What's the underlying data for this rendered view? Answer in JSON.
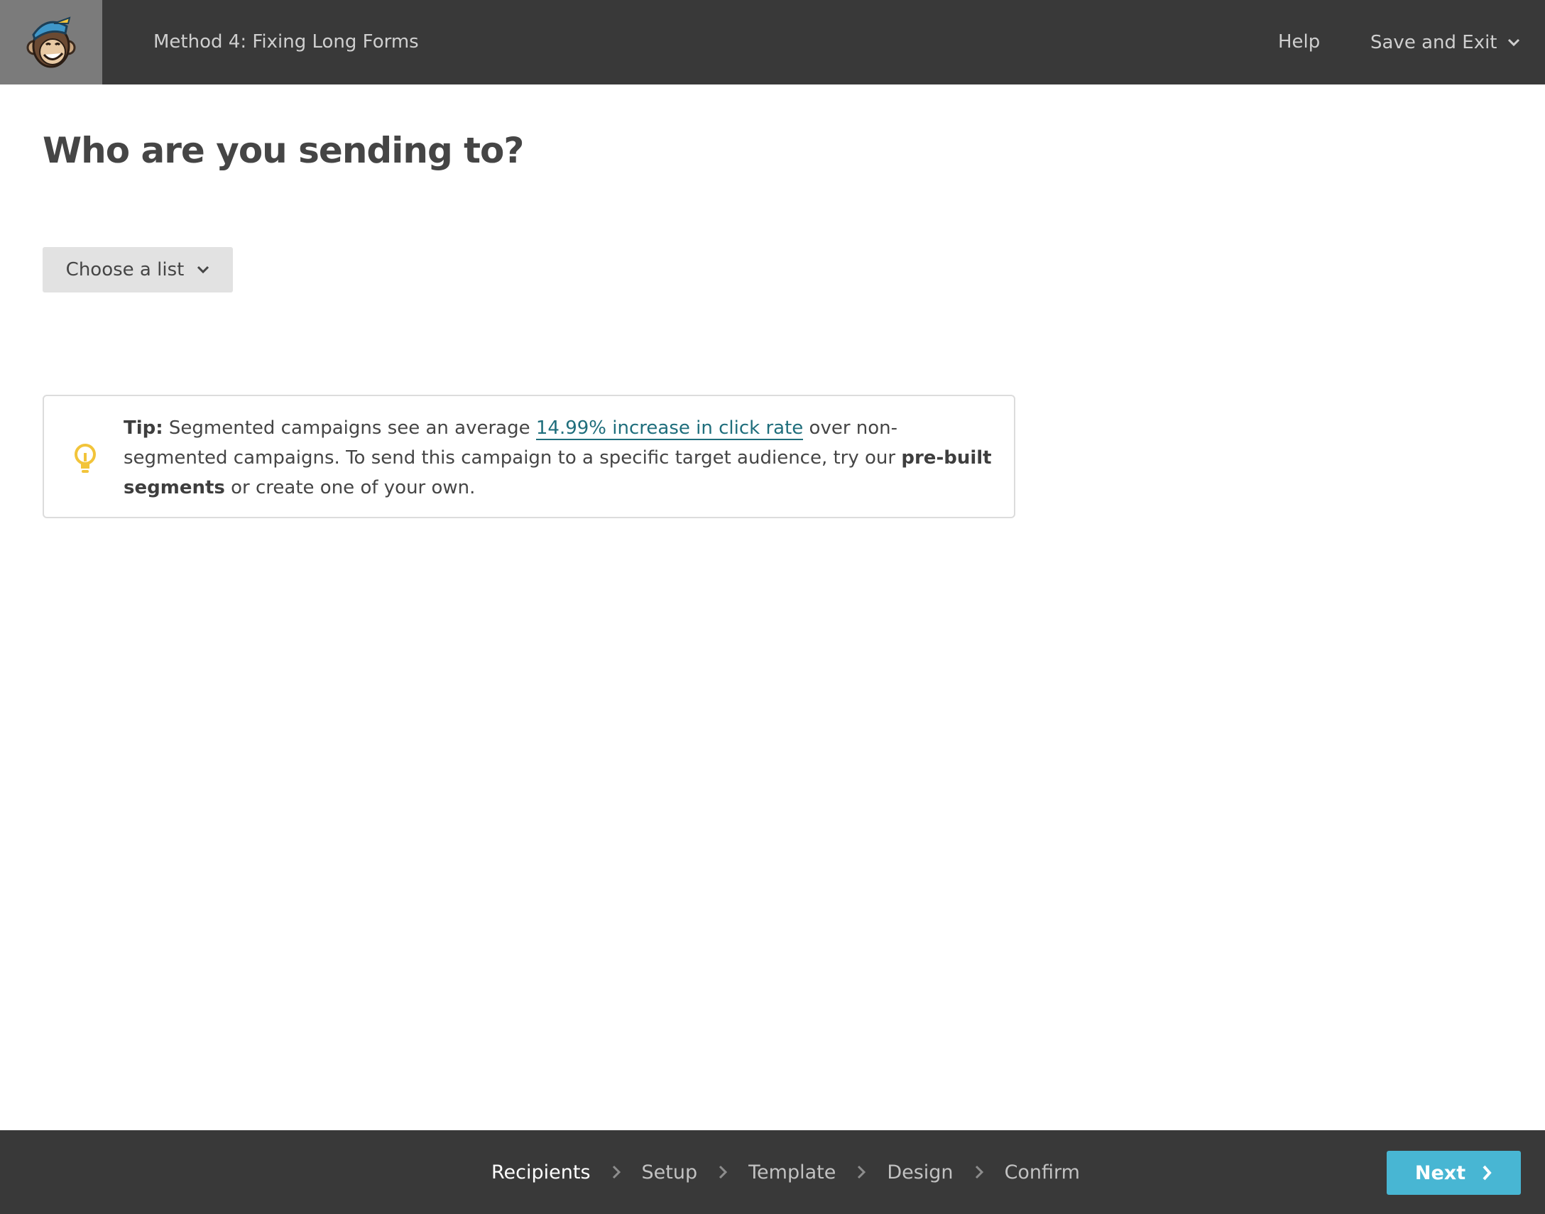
{
  "header": {
    "campaign_title": "Method 4: Fixing Long Forms",
    "help_label": "Help",
    "save_exit_label": "Save and Exit"
  },
  "main": {
    "title": "Who are you sending to?",
    "choose_list_label": "Choose a list"
  },
  "tip": {
    "lead": "Tip:",
    "text_before_link": " Segmented campaigns see an average ",
    "link_text": "14.99% increase in click rate",
    "text_after_link": " over non-segmented campaigns. To send this campaign to a specific target audience, try our ",
    "bold_text": "pre-built segments",
    "text_end": " or create one of your own."
  },
  "footer": {
    "steps": [
      {
        "label": "Recipients",
        "active": true
      },
      {
        "label": "Setup",
        "active": false
      },
      {
        "label": "Template",
        "active": false
      },
      {
        "label": "Design",
        "active": false
      },
      {
        "label": "Confirm",
        "active": false
      }
    ],
    "next_label": "Next"
  },
  "colors": {
    "topbar": "#393939",
    "logo_bg": "#7b7b7b",
    "accent_button": "#48b6d3",
    "link": "#1f6e7c",
    "tip_icon": "#f2c43a"
  },
  "icons": {
    "logo": "mailchimp-monkey-logo",
    "save_exit_caret": "chevron-down-icon",
    "choose_list_caret": "chevron-down-icon",
    "tip": "lightbulb-icon",
    "step_separator": "chevron-right-icon",
    "next": "chevron-right-icon"
  }
}
